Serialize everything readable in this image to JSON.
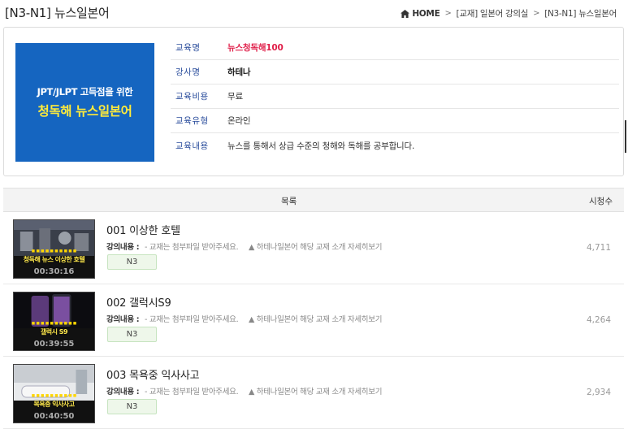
{
  "page": {
    "title": "[N3-N1] 뉴스일본어"
  },
  "breadcrumb": {
    "home": "HOME",
    "items": [
      "[교재] 일본어 강의실",
      "[N3-N1] 뉴스일본어"
    ]
  },
  "course": {
    "image": {
      "line1": "JPT/JLPT 고득점을 위한",
      "line2": "청독해 뉴스일본어"
    },
    "fields": [
      {
        "label": "교육명",
        "value": "뉴스청독해100"
      },
      {
        "label": "강사명",
        "value": "하테나"
      },
      {
        "label": "교육비용",
        "value": "무료"
      },
      {
        "label": "교육유형",
        "value": "온라인"
      },
      {
        "label": "교육내용",
        "value": "뉴스를 통해서 상급 수준의 청해와 독해를 공부합니다."
      }
    ]
  },
  "list": {
    "header_title": "목록",
    "header_views": "시청수",
    "lectures": [
      {
        "title": "001 이상한 호텔",
        "desc_label": "강의내용 :",
        "desc_text": "- 교재는 첨부파일 받아주세요.",
        "more_link": "▲ 하테나일본어 해당 교재 소개 자세히보기",
        "tag": "N3",
        "views": "4,711",
        "thumb_caption": "청독해 뉴스 이상한 호텔",
        "thumb_duration": "00:30:16"
      },
      {
        "title": "002 갤럭시S9",
        "desc_label": "강의내용 :",
        "desc_text": "- 교재는 첨부파일 받아주세요.",
        "more_link": "▲ 하테나일본어 해당 교재 소개 자세히보기",
        "tag": "N3",
        "views": "4,264",
        "thumb_caption": "갤럭시 S9",
        "thumb_duration": "00:39:55"
      },
      {
        "title": "003 목욕중 익사사고",
        "desc_label": "강의내용 :",
        "desc_text": "- 교재는 첨부파일 받아주세요.",
        "more_link": "▲ 하테나일본어 해당 교재 소개 자세히보기",
        "tag": "N3",
        "views": "2,934",
        "thumb_caption": "목욕중 익사사고",
        "thumb_duration": "00:40:50"
      }
    ]
  },
  "colors": {
    "label_blue": "#2a4d9c",
    "course_name_red": "#e0204a",
    "image_blue": "#1565c0",
    "caption_yellow": "#ffe94d",
    "tag_green_bg": "#eef7ea"
  }
}
